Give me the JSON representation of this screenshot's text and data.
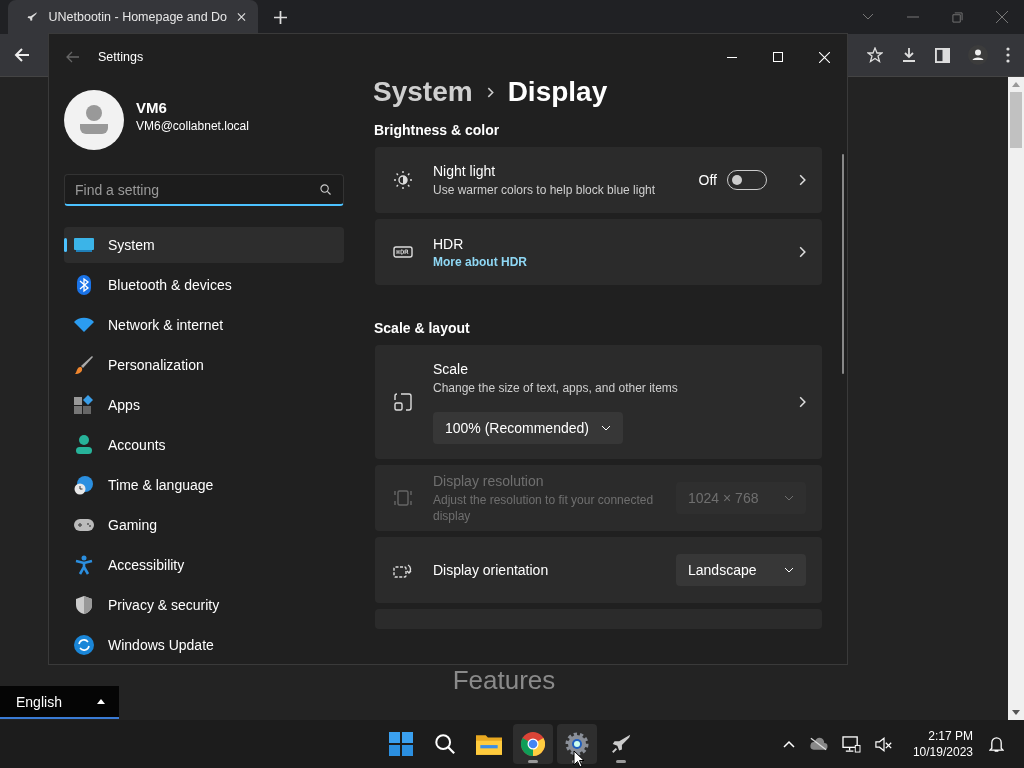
{
  "browser": {
    "tab": {
      "title": "UNetbootin - Homepage and Do"
    }
  },
  "page": {
    "heading": "Features",
    "language": {
      "value": "English"
    }
  },
  "settings": {
    "title": "Settings",
    "user": {
      "name": "VM6",
      "email": "VM6@collabnet.local"
    },
    "search": {
      "placeholder": "Find a setting"
    },
    "nav": [
      {
        "label": "System",
        "selected": true
      },
      {
        "label": "Bluetooth & devices",
        "selected": false
      },
      {
        "label": "Network & internet",
        "selected": false
      },
      {
        "label": "Personalization",
        "selected": false
      },
      {
        "label": "Apps",
        "selected": false
      },
      {
        "label": "Accounts",
        "selected": false
      },
      {
        "label": "Time & language",
        "selected": false
      },
      {
        "label": "Gaming",
        "selected": false
      },
      {
        "label": "Accessibility",
        "selected": false
      },
      {
        "label": "Privacy & security",
        "selected": false
      },
      {
        "label": "Windows Update",
        "selected": false
      }
    ],
    "breadcrumb": {
      "parent": "System",
      "current": "Display"
    },
    "sections": [
      {
        "title": "Brightness & color",
        "cards": [
          {
            "kind": "toggle",
            "title": "Night light",
            "description": "Use warmer colors to help block blue light",
            "state_label": "Off",
            "on": false,
            "disabled": false
          },
          {
            "kind": "link",
            "title": "HDR",
            "link": "More about HDR",
            "disabled": false
          }
        ]
      },
      {
        "title": "Scale & layout",
        "cards": [
          {
            "kind": "scale",
            "title": "Scale",
            "description": "Change the size of text, apps, and other items",
            "value": "100% (Recommended)",
            "disabled": false
          },
          {
            "kind": "select",
            "title": "Display resolution",
            "description": "Adjust the resolution to fit your connected display",
            "value": "1024 × 768",
            "disabled": true
          },
          {
            "kind": "select",
            "title": "Display orientation",
            "value": "Landscape",
            "disabled": false
          }
        ]
      }
    ]
  },
  "taskbar": {
    "apps": [
      {
        "kind": "start",
        "running": false
      },
      {
        "kind": "search",
        "running": false
      },
      {
        "kind": "explorer",
        "running": false
      },
      {
        "kind": "chrome",
        "running": true
      },
      {
        "kind": "settings",
        "running": true
      },
      {
        "kind": "unetbootin",
        "running": true
      }
    ],
    "time": "2:17 PM",
    "date": "10/19/2023"
  }
}
